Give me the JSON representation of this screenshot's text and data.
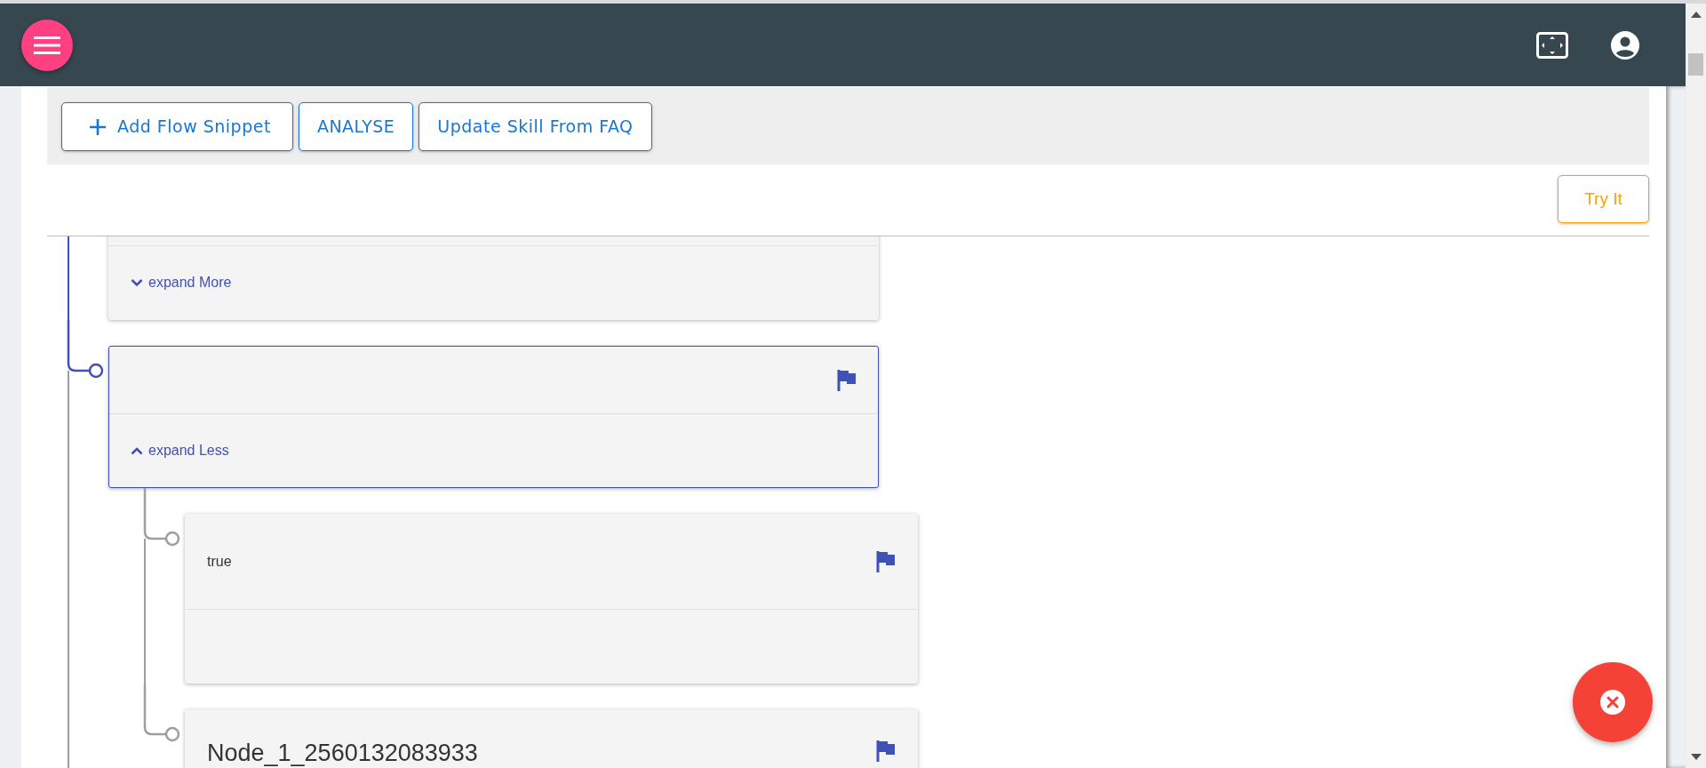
{
  "toolbar": {
    "buttons": [
      {
        "label": "Add Flow Snippet",
        "kind": "add"
      },
      {
        "label": "ANALYSE",
        "kind": "plain"
      },
      {
        "label": "Update Skill From FAQ",
        "kind": "plain"
      }
    ]
  },
  "try_button": {
    "label": "Try It"
  },
  "tree": [
    {
      "selected": false,
      "expanded": false,
      "toggle": "expand More"
    },
    {
      "selected": true,
      "flag": true,
      "expanded": true,
      "toggle": "expand Less",
      "children": [
        {
          "selected": false,
          "flag": true,
          "text": "true"
        },
        {
          "selected": false,
          "flag": true,
          "title": "Node_1_2560132083933"
        }
      ]
    }
  ]
}
